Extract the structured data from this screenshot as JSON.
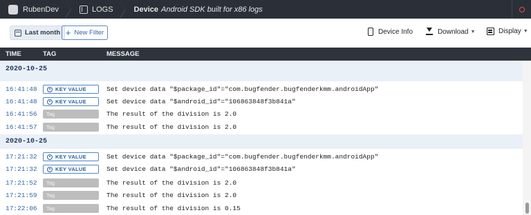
{
  "nav": {
    "app_name": "RubenDev",
    "logs_label": "LOGS",
    "device_label": "Device",
    "device_name": "Android SDK built for x86 logs"
  },
  "toolbar": {
    "last_month_label": "Last month",
    "new_filter_label": "New Filter",
    "device_info_label": "Device Info",
    "download_label": "Download",
    "display_label": "Display"
  },
  "table": {
    "col_time": "TIME",
    "col_tag": "TAG",
    "col_message": "MESSAGE"
  },
  "groups": [
    {
      "date": "2020-10-25",
      "rows": [
        {
          "time": "16:41:48",
          "tag": "KEY VALUE",
          "message": "Set device data \"$package_id\"=\"com.bugfender.bugfenderkmm.androidApp\""
        },
        {
          "time": "16:41:48",
          "tag": "KEY VALUE",
          "message": "Set device data \"$android_id\"=\"106863848f3b841a\""
        },
        {
          "time": "16:41:56",
          "tag": "Tag",
          "message": "The result of the division is 2.0"
        },
        {
          "time": "16:41:57",
          "tag": "Tag",
          "message": "The result of the division is 2.0"
        }
      ]
    },
    {
      "date": "2020-10-25",
      "rows": [
        {
          "time": "17:21:32",
          "tag": "KEY VALUE",
          "message": "Set device data \"$package_id\"=\"com.bugfender.bugfenderkmm.androidApp\""
        },
        {
          "time": "17:21:32",
          "tag": "KEY VALUE",
          "message": "Set device data \"$android_id\"=\"106863848f3b841a\""
        },
        {
          "time": "17:21:52",
          "tag": "Tag",
          "message": "The result of the division is 2.0"
        },
        {
          "time": "17:21:59",
          "tag": "Tag",
          "message": "The result of the division is 2.0"
        },
        {
          "time": "17:22:06",
          "tag": "Tag",
          "message": "The result of the division is 0.15"
        }
      ]
    }
  ]
}
